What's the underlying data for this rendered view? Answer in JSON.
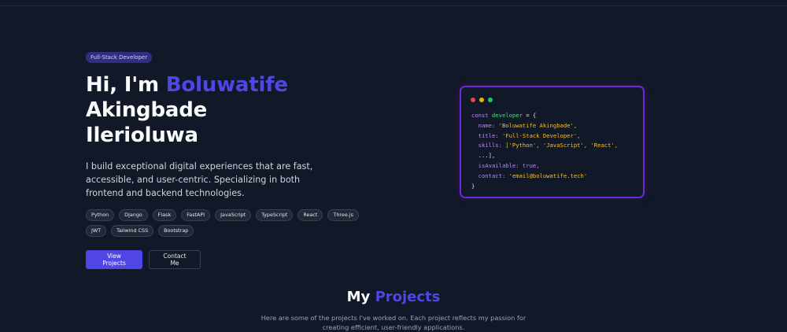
{
  "hero": {
    "badge": "Full-Stack Developer",
    "greeting": "Hi, I'm",
    "first_name": "Boluwatife",
    "last_name_line1": "Akingbade",
    "last_name_line2": "Ilerioluwa",
    "intro": "I build exceptional digital experiences that are fast, accessible, and user-centric. Specializing in both frontend and backend technologies.",
    "skills": [
      "Python",
      "Django",
      "Flask",
      "FastAPI",
      "JavaScript",
      "TypeScript",
      "React",
      "Three.js",
      "JWT",
      "Tailwind CSS",
      "Bootstrap"
    ],
    "primary_button": "View Projects",
    "secondary_button": "Contact Me"
  },
  "code_card": {
    "decl_keyword": "const",
    "var_name": "developer",
    "open": "= {",
    "name_key": "name:",
    "name_val": "'Boluwatife Akingbade',",
    "title_key": "title:",
    "title_val": "'Full-Stack Developer',",
    "skills_key": "skills:",
    "skills_val_line1": "['Python', 'JavaScript', 'React',",
    "skills_val_line2": "...],",
    "available_key": "isAvailable:",
    "available_val": "true,",
    "contact_key": "contact:",
    "contact_val": "'email@boluwatife.tech'",
    "close": "}"
  },
  "projects": {
    "title_prefix": "My",
    "title_accent": "Projects",
    "subtitle": "Here are some of the projects I've worked on. Each project reflects my passion for creating efficient, user-friendly applications."
  },
  "colors": {
    "background": "#111827",
    "accent": "#4f46e5",
    "card_border": "#6d28d9"
  }
}
